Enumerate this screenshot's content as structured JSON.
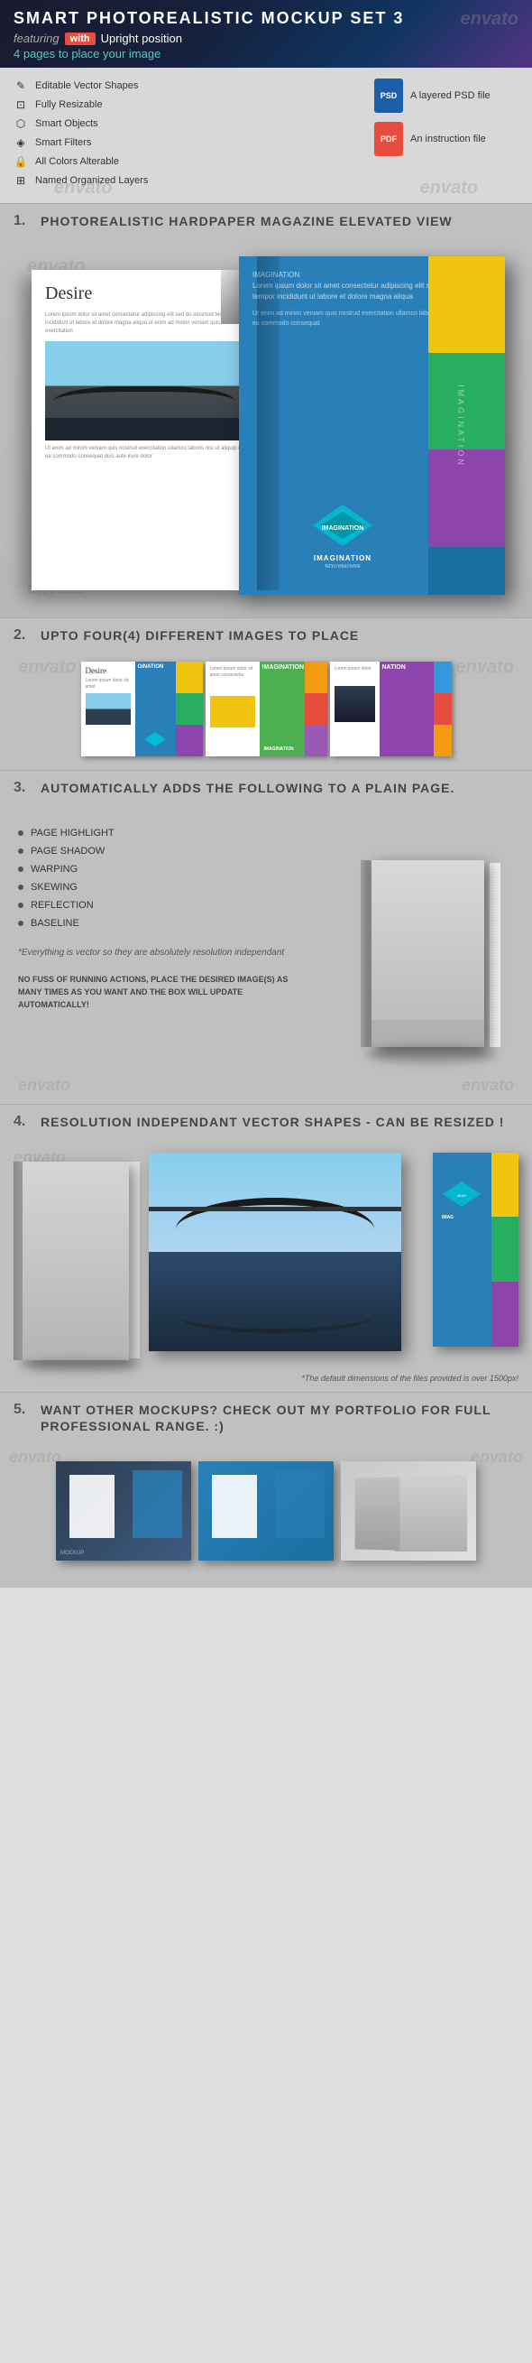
{
  "header": {
    "title": "SMART PHOTOREALISTIC MOCKUP SET 3",
    "featuring_label": "featuring",
    "with_badge": "with",
    "upright_text": "Upright position",
    "pages_text": "4 pages to place your image",
    "watermark": "envato"
  },
  "features": {
    "items": [
      {
        "label": "Editable Vector Shapes",
        "icon": "✎"
      },
      {
        "label": "Fully Resizable",
        "icon": "⊡"
      },
      {
        "label": "Smart Objects",
        "icon": "⬡"
      },
      {
        "label": "Smart Filters",
        "icon": "◈"
      },
      {
        "label": "All Colors Alterable",
        "icon": "🔒"
      },
      {
        "label": "Named Organized Layers",
        "icon": "⊞"
      }
    ],
    "files": [
      {
        "label": "A layered PSD file",
        "type": "PSD"
      },
      {
        "label": "An instruction file",
        "type": "PDF"
      }
    ]
  },
  "sections": [
    {
      "number": "1.",
      "title": "PHOTOREALISTIC HARDPAPER MAGAZINE ELEVATED VIEW"
    },
    {
      "number": "2.",
      "title": "UPTO FOUR(4) DIFFERENT IMAGES TO PLACE"
    },
    {
      "number": "3.",
      "title": "AUTOMATICALLY ADDS THE FOLLOWING TO A PLAIN PAGE."
    },
    {
      "number": "4.",
      "title": "RESOLUTION INDEPENDANT VECTOR SHAPES - CAN BE RESIZED !"
    },
    {
      "number": "5.",
      "title": "Want other mockups? Check out my portfolio for full professional range. :)"
    }
  ],
  "section3": {
    "bullets": [
      "PAGE HIGHLIGHT",
      "PAGE SHADOW",
      "WARPING",
      "SKEWING",
      "REFLECTION",
      "BASELINE"
    ],
    "italic_note": "*Everything is vector so they are absolutely resolution independant",
    "action_note": "NO FUSS OF RUNNING ACTIONS, PLACE THE DESIRED IMAGE(S) AS MANY TIMES AS YOU WANT AND THE BOX WILL UPDATE AUTOMATICALLY!"
  },
  "section4": {
    "resolution_note": "*The default dimensions of the files provided is over 1500px!"
  },
  "magazine": {
    "left_title": "Desire",
    "right_title": "IMAGINATION",
    "spine_word": "IMAGINATION"
  },
  "watermarks": [
    "envato",
    "envato",
    "envato",
    "envato"
  ]
}
